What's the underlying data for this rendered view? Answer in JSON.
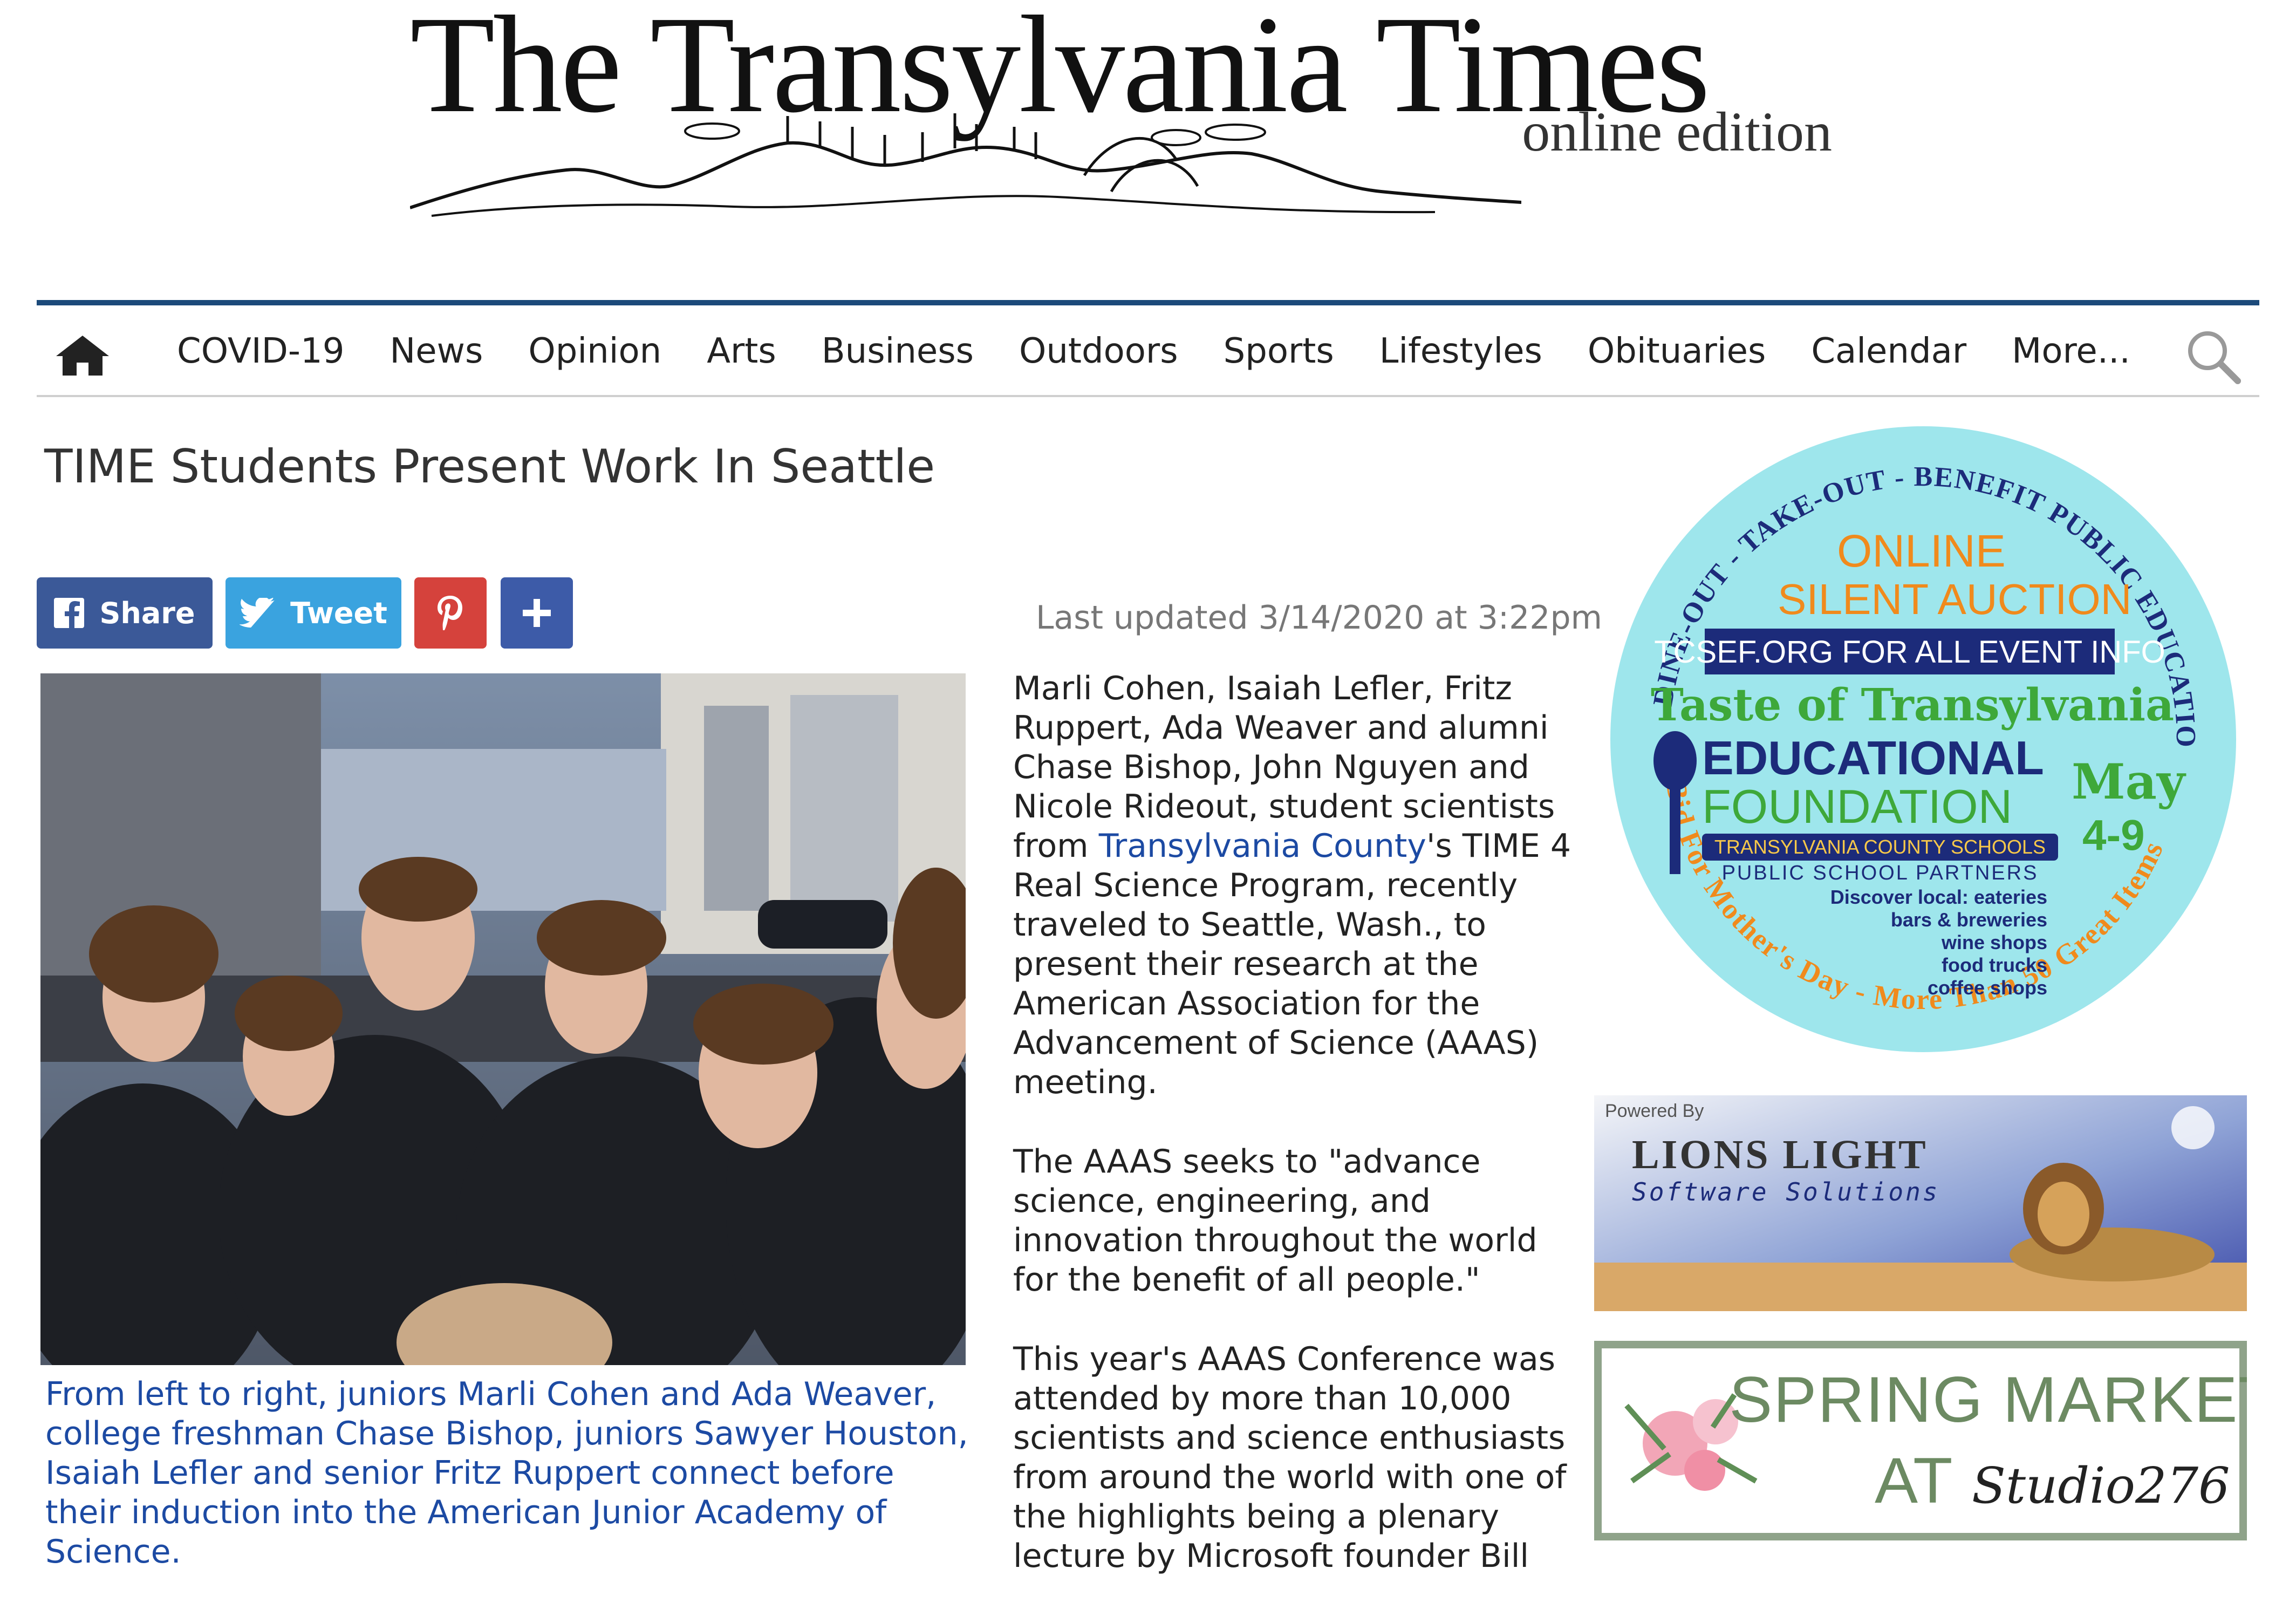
{
  "masthead": {
    "title": "The Transylvania Times",
    "subtitle": "online edition"
  },
  "nav": {
    "items": [
      "COVID-19",
      "News",
      "Opinion",
      "Arts",
      "Business",
      "Outdoors",
      "Sports",
      "Lifestyles",
      "Obituaries",
      "Calendar",
      "More..."
    ]
  },
  "article": {
    "headline": "TIME Students Present Work In Seattle",
    "updated": "Last updated 3/14/2020 at 3:22pm",
    "share": {
      "facebook": "Share",
      "twitter": "Tweet"
    },
    "caption": "From left to right, juniors Marli Cohen and Ada Weaver, college freshman Chase Bishop, juniors Sawyer Houston, Isaiah Lefler and senior Fritz Ruppert connect before their induction into the American Junior Academy of Science.",
    "p1_before": "Marli Cohen, Isaiah Lefler, Fritz Ruppert, Ada Weaver and alumni Chase Bishop, John Nguyen and Nicole Rideout, student scientists from ",
    "p1_link": "Transylvania County",
    "p1_after": "'s TIME 4 Real Science Program, recently traveled to Seattle, Wash., to present their research at the American Association for the Advancement of Science (AAAS) meeting.",
    "p2": "The AAAS seeks to \"advance science, engineering, and innovation throughout the world for the benefit of all people.\"",
    "p3": "This year's AAAS Conference was attended by more than 10,000 scientists and science enthusiasts from around the world with one of the highlights being a plenary lecture by Microsoft founder Bill"
  },
  "ads": {
    "taste": {
      "ring_top": "DINE-OUT - TAKE-OUT - BENEFIT PUBLIC EDUCATION",
      "ring_bottom": "Bid For Mother's Day - More Than 50 Great Items",
      "online": "ONLINE",
      "silent": "SILENT AUCTION",
      "tcsef": "TCSEF.ORG FOR ALL EVENT INFO",
      "taste_of": "Taste of Transylvania",
      "educational": "EDUCATIONAL",
      "foundation": "FOUNDATION",
      "schools": "TRANSYLVANIA COUNTY SCHOOLS",
      "partners": "PUBLIC SCHOOL PARTNERS",
      "may": "May",
      "dates": "4-9",
      "discover": [
        "Discover local: eateries",
        "bars & breweries",
        "wine shops",
        "food trucks",
        "coffee shops"
      ]
    },
    "lions": {
      "powered": "Powered By",
      "name": "LIONS LIGHT",
      "tagline": "Software Solutions"
    },
    "spring": {
      "line1": "SPRING MARKET",
      "at": "AT",
      "studio": "Studio276"
    }
  },
  "colors": {
    "nav_rule": "#1c4a7a",
    "link": "#1c4aa3",
    "facebook": "#3b5998",
    "twitter": "#3aa3df",
    "pinterest": "#d5423c",
    "more": "#3d5ba8",
    "ad_circle": "#9ee6ec",
    "ad_orange": "#f08a1c",
    "ad_navy": "#1c2b7a",
    "ad_green": "#3ea83a"
  }
}
